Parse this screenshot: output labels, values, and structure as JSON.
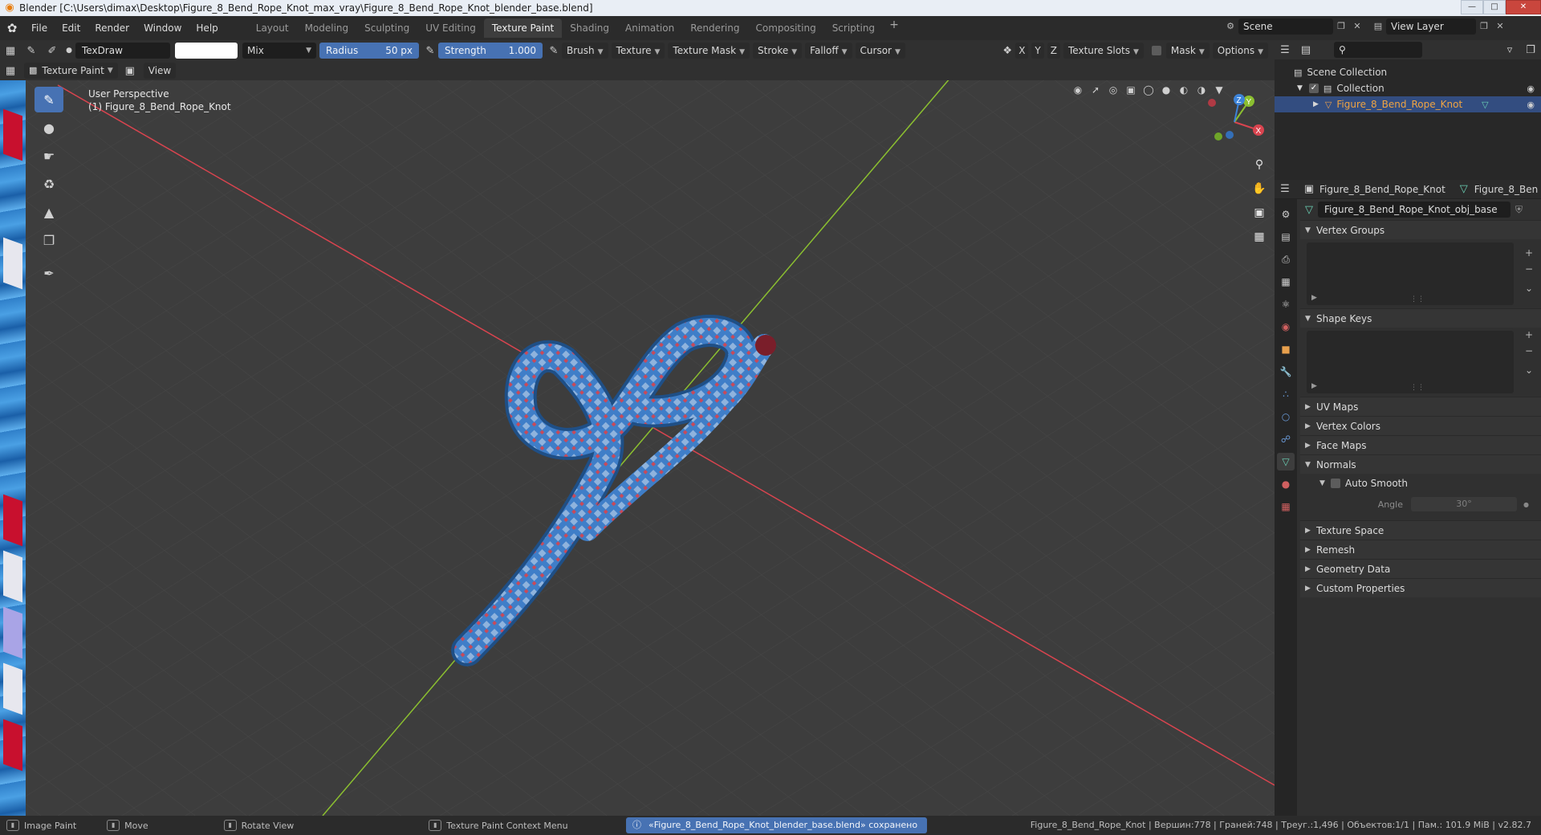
{
  "window": {
    "title": "Blender [C:\\Users\\dimax\\Desktop\\Figure_8_Bend_Rope_Knot_max_vray\\Figure_8_Bend_Rope_Knot_blender_base.blend]"
  },
  "menu": {
    "items": [
      "File",
      "Edit",
      "Render",
      "Window",
      "Help"
    ]
  },
  "workspaces": {
    "tabs": [
      "Layout",
      "Modeling",
      "Sculpting",
      "UV Editing",
      "Texture Paint",
      "Shading",
      "Animation",
      "Rendering",
      "Compositing",
      "Scripting"
    ],
    "active": "Texture Paint",
    "add": "+"
  },
  "scene": {
    "name": "Scene",
    "view_layer": "View Layer"
  },
  "tool_header": {
    "brush_name": "TexDraw",
    "blend": "Mix",
    "radius_label": "Radius",
    "radius_value": "50 px",
    "strength_label": "Strength",
    "strength_value": "1.000",
    "brush": "Brush",
    "texture": "Texture",
    "texture_mask": "Texture Mask",
    "stroke": "Stroke",
    "falloff": "Falloff",
    "cursor": "Cursor",
    "axis_x": "X",
    "axis_y": "Y",
    "axis_z": "Z",
    "texture_slots": "Texture Slots",
    "mask": "Mask",
    "options": "Options"
  },
  "mode_header": {
    "mode": "Texture Paint",
    "view": "View"
  },
  "viewport": {
    "perspective": "User Perspective",
    "object_label": "(1) Figure_8_Bend_Rope_Knot",
    "gizmo": {
      "x": "X",
      "y": "Y",
      "z": "Z"
    },
    "colors": {
      "x_axis": "#d9444f",
      "y_axis": "#8bbf30",
      "z_axis": "#3d83d8",
      "rope": "#3f7ec8",
      "rope_check": "#c84a5a"
    }
  },
  "outliner": {
    "scene_collection": "Scene Collection",
    "collection": "Collection",
    "object": "Figure_8_Bend_Rope_Knot"
  },
  "properties": {
    "object_name": "Figure_8_Bend_Rope_Knot",
    "data_name_short": "Figure_8_Ben",
    "mesh_name": "Figure_8_Bend_Rope_Knot_obj_base",
    "panels": {
      "vertex_groups": "Vertex Groups",
      "shape_keys": "Shape Keys",
      "uv_maps": "UV Maps",
      "vertex_colors": "Vertex Colors",
      "face_maps": "Face Maps",
      "normals": "Normals",
      "auto_smooth": "Auto Smooth",
      "angle_label": "Angle",
      "angle_value": "30°",
      "texture_space": "Texture Space",
      "remesh": "Remesh",
      "geometry_data": "Geometry Data",
      "custom_properties": "Custom Properties"
    }
  },
  "statusbar": {
    "image_paint": "Image Paint",
    "move": "Move",
    "rotate_view": "Rotate View",
    "context_menu": "Texture Paint Context Menu",
    "message": "«Figure_8_Bend_Rope_Knot_blender_base.blend» сохранено",
    "stats": "Figure_8_Bend_Rope_Knot | Вершин:778 | Граней:748 | Треуг.:1,496 | Объектов:1/1 | Пам.: 101.9 MiB | v2.82.7"
  }
}
